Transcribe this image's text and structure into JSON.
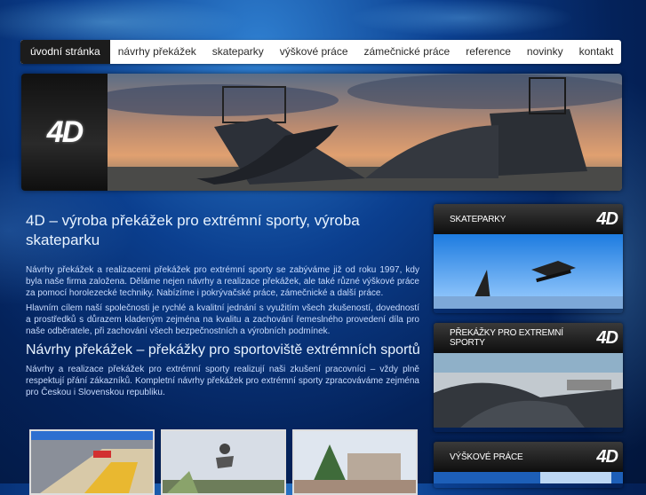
{
  "nav": {
    "items": [
      {
        "label": "úvodní stránka",
        "active": true
      },
      {
        "label": "návrhy překážek"
      },
      {
        "label": "skateparky"
      },
      {
        "label": "výškové práce"
      },
      {
        "label": "zámečnické práce"
      },
      {
        "label": "reference"
      },
      {
        "label": "novinky"
      },
      {
        "label": "kontakt"
      }
    ]
  },
  "banner": {
    "logo": "4D"
  },
  "main": {
    "title": "4D – výroba překážek pro extrémní sporty, výroba skateparku",
    "p1": "Návrhy překážek a realizacemi překážek pro extrémní sporty se zabýváme již od roku 1997, kdy byla naše firma založena. Děláme nejen návrhy a realizace překážek, ale také různé výškové práce za pomocí horolezecké techniky. Nabízíme i pokrývačské práce, zámečnické a další práce.",
    "p2": "Hlavním cílem naší společnosti je rychlé a kvalitní jednání s využitím všech zkušeností, dovedností a prostředků s důrazem kladeným zejména na kvalitu a zachování řemeslného provedení díla pro naše odběratele, při zachování všech bezpečnostních a výrobních podmínek.",
    "subtitle": "Návrhy překážek – překážky pro sportoviště extrémních sportů",
    "p3": "Návrhy a realizace překážek pro extrémní sporty realizují naši zkušení pracovníci – vždy plně respektují přání zákazníků. Kompletní návrhy překážek pro extrémní sporty zpracováváme zejména pro Českou i Slovenskou republiku."
  },
  "sidebar": {
    "cards": [
      {
        "title": "SKATEPARKY",
        "logo": "4D"
      },
      {
        "title": "PŘEKÁŽKY PRO EXTREMNÍ SPORTY",
        "logo": "4D"
      },
      {
        "title": "VÝŠKOVÉ PRÁCE",
        "logo": "4D"
      }
    ]
  }
}
